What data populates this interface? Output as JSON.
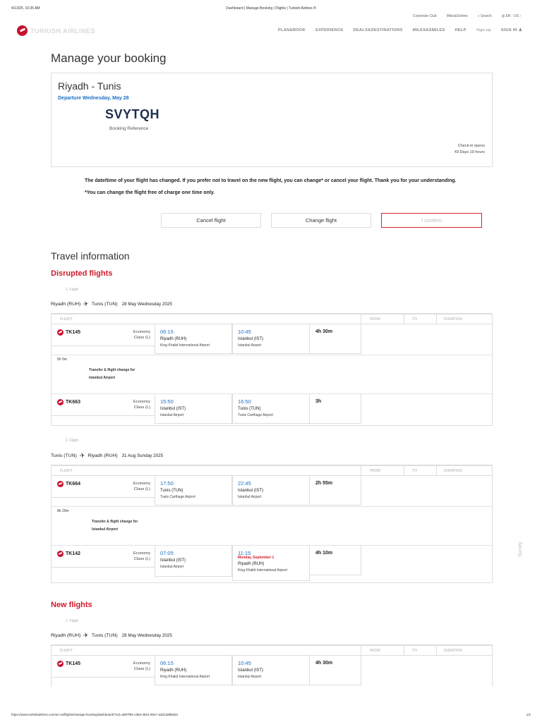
{
  "print": {
    "timestamp": "4/13/25, 10:35 AM",
    "page_title": "Dashboard | Manage Booking | Flights | Turkish Airlines ®",
    "url": "https://www.turkishairlines.com/en-us/flights/manage-booking/dashboard/?cid=a897f82-cd83-4b01-90e7-a3d13d8bdd4",
    "page": "1/2"
  },
  "header": {
    "util": {
      "corporate": "Corporate Club",
      "miles": "Miles&Smiles",
      "search": "Search",
      "lang": "EN - US"
    },
    "logo_text": "TURKISH AIRLINES",
    "nav": [
      "PLAN&BOOK",
      "EXPERIENCE",
      "DEALS&DESTINATIONS",
      "MILES&SMILES",
      "HELP"
    ],
    "signup": "Sign up",
    "signin": "SIGN IN"
  },
  "page_title": "Manage your booking",
  "booking": {
    "route": "Riyadh - Tunis",
    "departure": "Departure Wednesday, May 28",
    "pnr": "SVYTQH",
    "pnr_label": "Booking Reference",
    "checkin_label": "Check-in opens",
    "checkin_value": "43 Days 19 hours"
  },
  "notice": {
    "text1": "The date/time of your flight has changed. If you prefer not to travel on the new flight, you can change* or cancel your flight. Thank you for your understanding.",
    "text2": "*You can change the flight free of charge one time only."
  },
  "actions": {
    "cancel": "Cancel flight",
    "change": "Change flight",
    "confirm": "I confirm"
  },
  "travel_info": "Travel information",
  "table_head": {
    "flight": "FLIGHT",
    "from": "FROM",
    "to": "TO",
    "duration": "DURATION"
  },
  "disrupted": {
    "title": "Disrupted flights",
    "f1": {
      "num": "1. Flight",
      "origin": "Riyadh (RUH)",
      "dest": "Tunis (TUN)",
      "date": "28 May Wednesday 2025",
      "s1": {
        "flight": "TK145",
        "class1": "Economy",
        "class2": "Class (L)",
        "dep_time": "06:15",
        "dep_city": "Riyadh (RUH)",
        "dep_ap": "King Khalid International Airport",
        "arr_time": "10:45",
        "arr_city": "Istanbul (IST)",
        "arr_ap": "Istanbul Airport",
        "dur": "4h 30m"
      },
      "transfer": {
        "wait": "5h 5m",
        "line1": "Transfer & flight change for",
        "line2": "Istanbul Airport"
      },
      "s2": {
        "flight": "TK663",
        "class1": "Economy",
        "class2": "Class (L)",
        "dep_time": "15:50",
        "dep_city": "Istanbul (IST)",
        "dep_ap": "Istanbul Airport",
        "arr_time": "16:50",
        "arr_city": "Tunis (TUN)",
        "arr_ap": "Tunis Carthage Airport",
        "dur": "3h"
      }
    },
    "f2": {
      "num": "2. Flight",
      "origin": "Tunis (TUN)",
      "dest": "Riyadh (RUH)",
      "date": "31 Aug Sunday 2025",
      "s1": {
        "flight": "TK664",
        "class1": "Economy",
        "class2": "Class (L)",
        "dep_time": "17:50",
        "dep_city": "Tunis (TUN)",
        "dep_ap": "Tunis Carthage Airport",
        "arr_time": "22:45",
        "arr_city": "Istanbul (IST)",
        "arr_ap": "Istanbul Airport",
        "dur": "2h 55m"
      },
      "transfer": {
        "wait": "8h 20m",
        "line1": "Transfer & flight change for",
        "line2": "Istanbul Airport"
      },
      "s2": {
        "flight": "TK142",
        "class1": "Economy",
        "class2": "Class (L)",
        "dep_time": "07:05",
        "dep_city": "Istanbul (IST)",
        "dep_ap": "Istanbul Airport",
        "arr_time": "11:15",
        "arr_next": "Monday, September 1",
        "arr_city": "Riyadh (RUH)",
        "arr_ap": "King Khalid International Airport",
        "dur": "4h 10m"
      }
    }
  },
  "new_flights": {
    "title": "New flights",
    "f1": {
      "num": "1. Flight",
      "origin": "Riyadh (RUH)",
      "dest": "Tunis (TUN)",
      "date": "28 May Wednesday 2025",
      "s1": {
        "flight": "TK145",
        "class1": "Economy",
        "class2": "Class (L)",
        "dep_time": "06:15",
        "dep_city": "Riyadh (RUH)",
        "dep_ap": "King Khalid International Airport",
        "arr_time": "10:45",
        "arr_city": "Istanbul (IST)",
        "arr_ap": "Istanbul Airport",
        "dur": "4h 30m"
      }
    }
  },
  "survey": "Survey"
}
